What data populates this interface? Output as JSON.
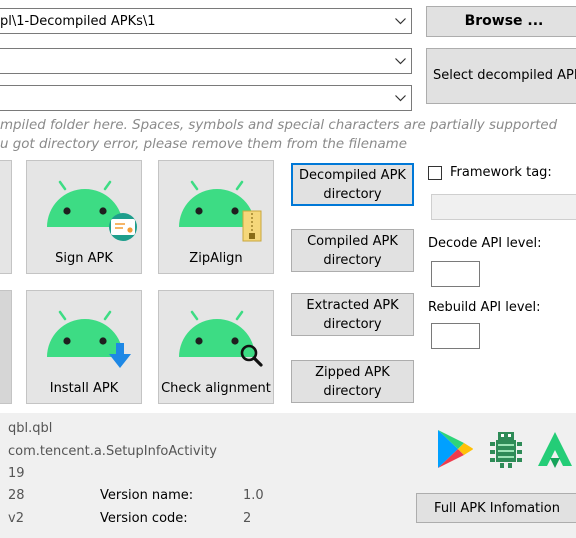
{
  "paths": {
    "decompiled_dir": "pl\\1-Decompiled APKs\\1",
    "combo2": "",
    "combo3": ""
  },
  "buttons": {
    "browse": "Browse ...",
    "select_decompiled": "Select decompiled APK",
    "decompiled_dir": [
      "Decompiled APK",
      "directory"
    ],
    "compiled_dir": [
      "Compiled APK",
      "directory"
    ],
    "extracted_dir": [
      "Extracted APK",
      "directory"
    ],
    "zipped_dir": [
      "Zipped APK",
      "directory"
    ],
    "full_info": "Full APK Infomation"
  },
  "hints": {
    "line1": "mpiled folder here. Spaces, symbols and special characters are partially supported",
    "line2": "u got directory error, please remove them from the filename"
  },
  "tiles": {
    "sign": "Sign APK",
    "zipalign": "ZipAlign",
    "install": "Install APK",
    "check": "Check alignment"
  },
  "options": {
    "framework_tag": "Framework tag:",
    "framework_checked": false,
    "framework_value": "",
    "decode_api": "Decode API level:",
    "decode_value": "",
    "rebuild_api": "Rebuild API level:",
    "rebuild_value": ""
  },
  "apk_info": {
    "package": "qbl.qbl",
    "activity": "com.tencent.a.SetupInfoActivity",
    "min_sdk": "19",
    "target_sdk": "28",
    "signature": "v2",
    "version_name_label": "Version name:",
    "version_name": "1.0",
    "version_code_label": "Version code:",
    "version_code": "2"
  },
  "colors": {
    "android_green": "#3ddc84",
    "focus_blue": "#0078d7",
    "button_bg": "#e1e1e1",
    "panel_bg": "#f0f0f0"
  },
  "icons": [
    "chevron-down-icon",
    "android-icon",
    "certificate-icon",
    "zipper-icon",
    "download-arrow-icon",
    "magnifier-icon",
    "google-play-icon",
    "android-bug-icon",
    "apkpure-icon"
  ]
}
